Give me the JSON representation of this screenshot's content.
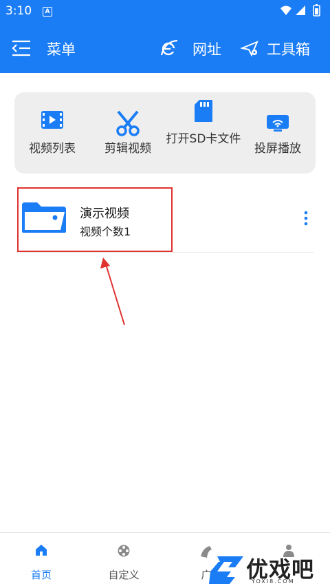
{
  "status_bar": {
    "time": "3:10",
    "notification_icon": "a-icon"
  },
  "app_bar": {
    "menu_label": "菜单",
    "url_label": "网址",
    "tools_label": "工具箱"
  },
  "quick_actions": [
    {
      "label": "视频列表",
      "icon": "video-list-icon"
    },
    {
      "label": "剪辑视频",
      "icon": "scissors-icon"
    },
    {
      "label": "打开SD卡文件",
      "icon": "sd-card-icon"
    },
    {
      "label": "投屏播放",
      "icon": "screen-cast-icon"
    }
  ],
  "folder": {
    "name": "演示视频",
    "count_text": "视频个数1"
  },
  "bottom_nav": [
    {
      "label": "首页",
      "active": true
    },
    {
      "label": "自定义",
      "active": false
    },
    {
      "label": "广",
      "active": false
    },
    {
      "label": "",
      "active": false
    }
  ],
  "watermark": {
    "text": "优戏吧",
    "sub": "YOXI8.COM"
  },
  "colors": {
    "primary": "#1b7df5",
    "annotation": "#e0322f"
  }
}
